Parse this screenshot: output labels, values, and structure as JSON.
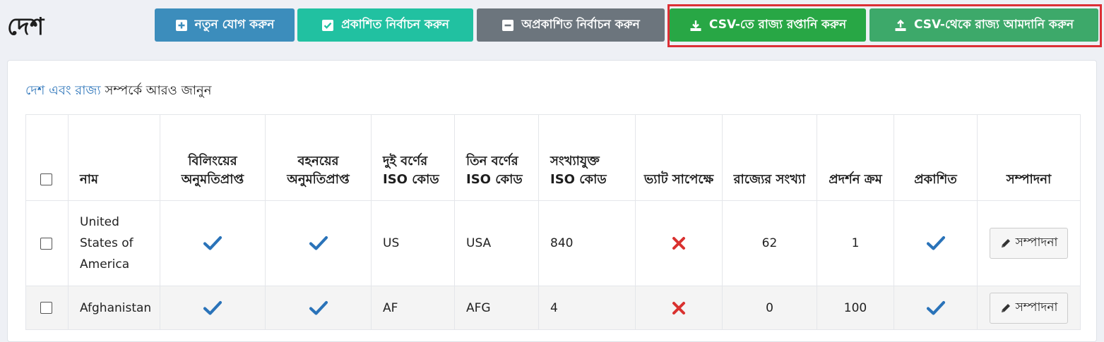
{
  "page": {
    "title": "দেশ"
  },
  "toolbar": {
    "add_label": "নতুন যোগ করুন",
    "select_published_label": "প্রকাশিত নির্বাচন করুন",
    "select_unpublished_label": "অপ্রকাশিত নির্বাচন করুন",
    "export_label": "CSV-তে রাজ্য রপ্তানি করুন",
    "import_label": "CSV-থেকে রাজ্য আমদানি করুন"
  },
  "learn_more": {
    "link_text": "দেশ এবং রাজ্য",
    "rest_text": " সম্পর্কে আরও জানুন"
  },
  "table": {
    "headers": {
      "name": "নাম",
      "billing": "বিলিংয়ের অনুমতিপ্রাপ্ত",
      "shipping": "বহনয়ের অনুমতিপ্রাপ্ত",
      "iso2": "দুই বর্ণের ISO কোড",
      "iso3": "তিন বর্ণের ISO কোড",
      "numeric_iso": "সংখ্যাযুক্ত ISO কোড",
      "vat": "ভ্যাট সাপেক্ষে",
      "state_count": "রাজ্যের সংখ্যা",
      "display_order": "প্রদর্শন ক্রম",
      "published": "প্রকাশিত",
      "edit": "সম্পাদনা"
    },
    "rows": [
      {
        "name": "United States of America",
        "billing": true,
        "shipping": true,
        "iso2": "US",
        "iso3": "USA",
        "numeric_iso": "840",
        "vat": false,
        "state_count": "62",
        "display_order": "1",
        "published": true,
        "edit_label": "সম্পাদনা"
      },
      {
        "name": "Afghanistan",
        "billing": true,
        "shipping": true,
        "iso2": "AF",
        "iso3": "AFG",
        "numeric_iso": "4",
        "vat": false,
        "state_count": "0",
        "display_order": "100",
        "published": true,
        "edit_label": "সম্পাদনা"
      }
    ]
  },
  "colors": {
    "check": "#2a73b9",
    "cross": "#d9312f",
    "highlight": "#dc2f35"
  },
  "icons": {
    "add": "plus-square-icon",
    "published": "check-square-icon",
    "unpublished": "minus-square-icon",
    "export": "download-icon",
    "import": "upload-icon",
    "edit": "pencil-icon"
  }
}
